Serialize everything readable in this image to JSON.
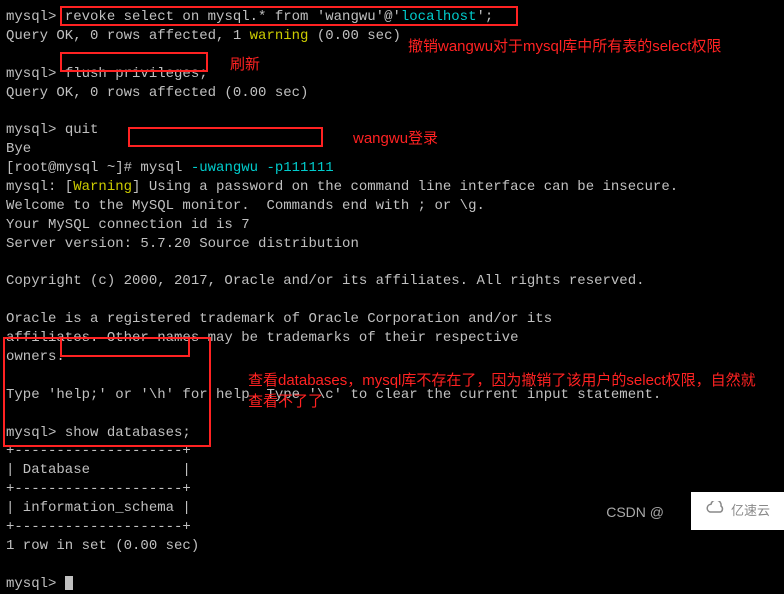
{
  "terminal": {
    "l1_prompt": "mysql> ",
    "l1_cmd": "revoke select on mysql.* from 'wangwu'@'",
    "l1_host": "localhost",
    "l1_end": "';",
    "l2_a": "Query OK, 0 rows affected, 1 ",
    "l2_warn": "warning",
    "l2_b": " (0.00 sec)",
    "l3_blank": " ",
    "l4_prompt": "mysql> ",
    "l4_cmd": "flush privileges;",
    "l5": "Query OK, 0 rows affected (0.00 sec)",
    "l6_blank": " ",
    "l7_prompt": "mysql> ",
    "l7_cmd": "quit",
    "l8": "Bye",
    "l9_a": "[root@mysql ~]# ",
    "l9_b": "mysql ",
    "l9_c": "-uwangwu -p111111",
    "l10_a": "mysql: [",
    "l10_warn": "Warning",
    "l10_b": "] Using a password on the command line interface can be insecure.",
    "l11": "Welcome to the MySQL monitor.  Commands end with ; or \\g.",
    "l12": "Your MySQL connection id is 7",
    "l13": "Server version: 5.7.20 Source distribution",
    "l14_blank": " ",
    "l15": "Copyright (c) 2000, 2017, Oracle and/or its affiliates. All rights reserved.",
    "l16_blank": " ",
    "l17": "Oracle is a registered trademark of Oracle Corporation and/or its",
    "l18": "affiliates. Other names may be trademarks of their respective",
    "l19": "owners.",
    "l20_blank": " ",
    "l21": "Type 'help;' or '\\h' for help. Type '\\c' to clear the current input statement.",
    "l22_blank": " ",
    "l23_prompt": "mysql> ",
    "l23_cmd": "show databases;",
    "l24": "+--------------------+",
    "l25": "| Database           |",
    "l26": "+--------------------+",
    "l27": "| information_schema |",
    "l28": "+--------------------+",
    "l29": "1 row in set (0.00 sec)",
    "l30_blank": " ",
    "l31_prompt": "mysql> "
  },
  "annotations": {
    "a1": "撤销wangwu对于mysql库中所有表的select权限",
    "a2": "刷新",
    "a3": "wangwu登录",
    "a4_l1": "查看databases，mysql库不存在了，因为撤销了该用户的select权限，自然就",
    "a4_l2": "查看不了了"
  },
  "watermark": {
    "csdn": "CSDN @",
    "brand": "亿速云"
  }
}
